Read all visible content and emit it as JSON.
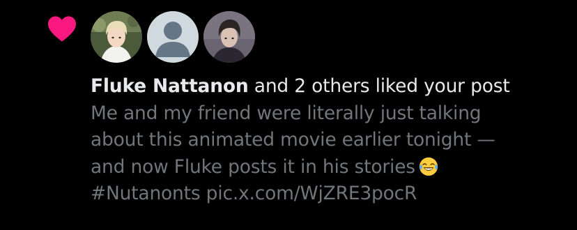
{
  "notification": {
    "type_icon": "heart-icon",
    "accent_color": "#f91880",
    "avatars": [
      {
        "name": "avatar-fluke-nattanon",
        "kind": "photo"
      },
      {
        "name": "avatar-default",
        "kind": "default-silhouette"
      },
      {
        "name": "avatar-user-3",
        "kind": "photo"
      }
    ],
    "actor_name": "Fluke Nattanon",
    "action_text": " and 2 others liked your post",
    "post_lines": [
      "Me and my friend were literally just talking",
      "about this animated movie earlier tonight —",
      "and now Fluke posts it in his stories",
      "#Nutanonts pic.x.com/WjZRE3pocR"
    ],
    "emoji": "face-with-tears-of-joy"
  }
}
